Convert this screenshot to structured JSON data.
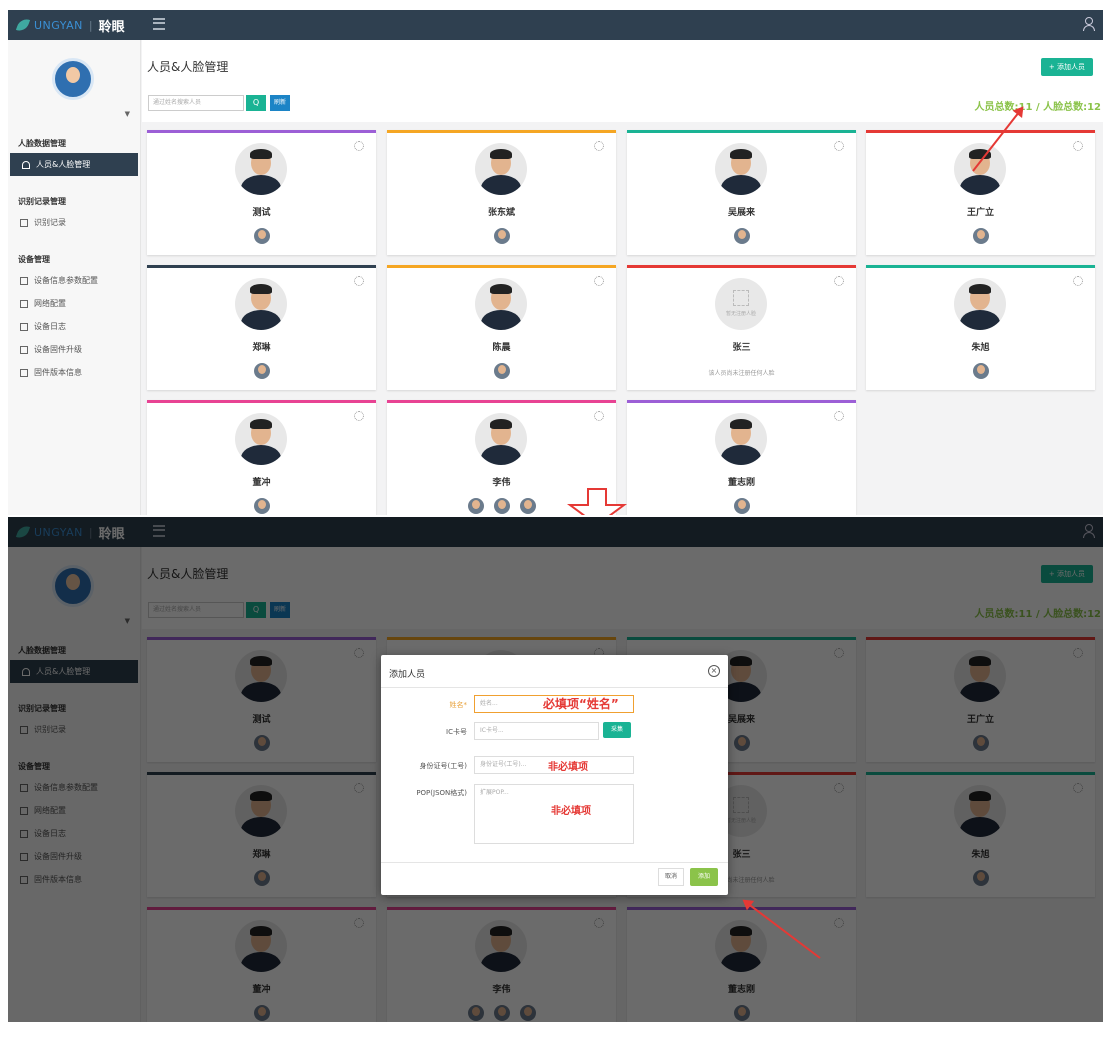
{
  "app": {
    "brand_latin": "UNGYAN",
    "brand_cn": "聆眼"
  },
  "page": {
    "title": "人员&人脸管理",
    "add_button": "+ 添加人员",
    "search_placeholder": "通过姓名搜索人员",
    "search_icon_label": "Q",
    "refresh_button": "刷新",
    "totals": "人员总数:11 / 人脸总数:12"
  },
  "sidebar": {
    "sections": [
      {
        "title": "人脸数据管理",
        "items": [
          {
            "label": "人员&人脸管理",
            "active": true
          }
        ]
      },
      {
        "title": "识别记录管理",
        "items": [
          {
            "label": "识别记录",
            "active": false
          }
        ]
      },
      {
        "title": "设备管理",
        "items": [
          {
            "label": "设备信息参数配置",
            "active": false
          },
          {
            "label": "网络配置",
            "active": false
          },
          {
            "label": "设备日志",
            "active": false
          },
          {
            "label": "设备固件升级",
            "active": false
          },
          {
            "label": "固件版本信息",
            "active": false
          }
        ]
      }
    ]
  },
  "people": [
    {
      "name": "测试",
      "color": "#9c5fd6",
      "thumbs": 1,
      "has_face": true
    },
    {
      "name": "张东斌",
      "color": "#f5a623",
      "thumbs": 1,
      "has_face": true
    },
    {
      "name": "吴展来",
      "color": "#1ab394",
      "thumbs": 1,
      "has_face": true
    },
    {
      "name": "王广立",
      "color": "#e53935",
      "thumbs": 1,
      "has_face": true
    },
    {
      "name": "郑琳",
      "color": "#2f4050",
      "thumbs": 1,
      "has_face": true
    },
    {
      "name": "陈晨",
      "color": "#f5a623",
      "thumbs": 1,
      "has_face": true
    },
    {
      "name": "张三",
      "color": "#e53935",
      "thumbs": 0,
      "has_face": false,
      "no_face_text": "该人员尚未注册任何人脸",
      "placeholder_text": "暂无注册人脸"
    },
    {
      "name": "朱旭",
      "color": "#1ab394",
      "thumbs": 1,
      "has_face": true
    },
    {
      "name": "董冲",
      "color": "#e84393",
      "thumbs": 1,
      "has_face": true
    },
    {
      "name": "李伟",
      "color": "#e84393",
      "thumbs": 3,
      "has_face": true
    },
    {
      "name": "董志刚",
      "color": "#9c5fd6",
      "thumbs": 1,
      "has_face": true
    }
  ],
  "modal": {
    "title": "添加人员",
    "close": "×",
    "name_label": "姓名*",
    "name_placeholder": "姓名...",
    "name_annotation": "必填项“姓名”",
    "ic_label": "IC卡号",
    "ic_placeholder": "IC卡号...",
    "collect_button": "采集",
    "id_label": "身份证号(工号)",
    "id_placeholder": "身份证号(工号)...",
    "id_annotation": "非必填项",
    "pop_label": "POP(JSON格式)",
    "pop_placeholder": "扩展POP...",
    "pop_annotation": "非必填项",
    "cancel_button": "取消",
    "ok_button": "添加"
  }
}
